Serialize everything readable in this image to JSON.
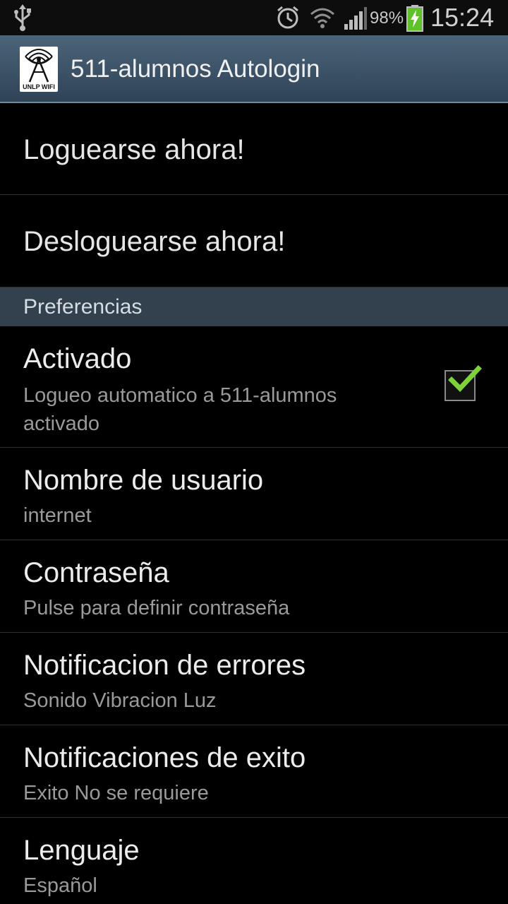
{
  "status_bar": {
    "battery_percent": "98%",
    "time": "15:24",
    "icons": [
      "usb-icon",
      "alarm-icon",
      "wifi-icon",
      "signal-icon",
      "battery-charging-icon"
    ]
  },
  "action_bar": {
    "app_icon_text": "UNLP WIFI",
    "title": "511-alumnos Autologin"
  },
  "actions": {
    "login": "Loguearse ahora!",
    "logout": "Desloguearse ahora!"
  },
  "preferences": {
    "category": "Preferencias",
    "activated": {
      "title": "Activado",
      "summary": "Logueo automatico a 511-alumnos activado",
      "checked": true
    },
    "username": {
      "title": "Nombre de usuario",
      "summary": "internet"
    },
    "password": {
      "title": "Contraseña",
      "summary": "Pulse para definir contraseña"
    },
    "error_notifications": {
      "title": "Notificacion de errores",
      "summary": "Sonido Vibracion Luz"
    },
    "success_notifications": {
      "title": "Notificaciones de exito",
      "summary": "Exito No se requiere"
    },
    "language": {
      "title": "Lenguaje",
      "summary": "Español"
    }
  },
  "colors": {
    "action_bar": "#3e5468",
    "category_bg": "#33414e",
    "check_accent": "#7fd33a",
    "battery_green": "#5fc22a"
  }
}
